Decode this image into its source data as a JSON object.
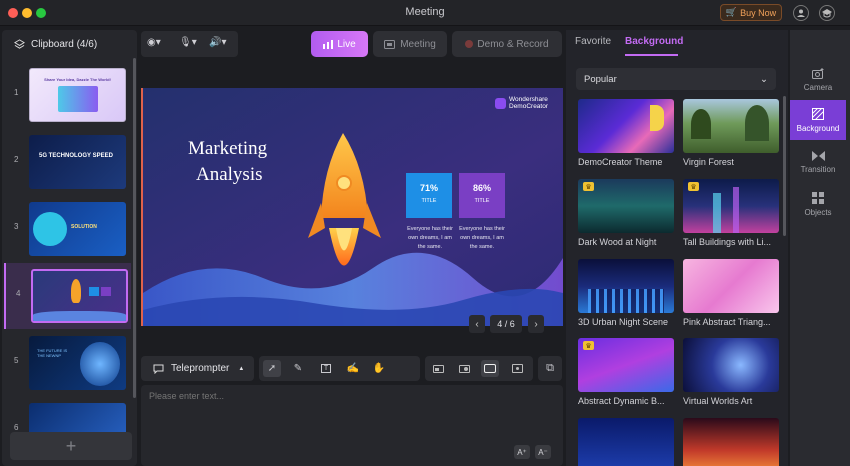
{
  "window": {
    "title": "Meeting"
  },
  "topbar": {
    "buy_now": "Buy Now",
    "buy_icon": "cart-icon",
    "avatar_icon": "user-icon",
    "settings_icon": "graduation-cap-icon"
  },
  "clipboard": {
    "header": "Clipboard (4/6)",
    "slides": [
      {
        "num": "1",
        "caption": "Share Your Idea, Dazzle The World!",
        "selected": false
      },
      {
        "num": "2",
        "caption": "5G TECHNOLOGY SPEED",
        "selected": false
      },
      {
        "num": "3",
        "caption": "SOLUTION",
        "selected": false
      },
      {
        "num": "4",
        "caption": "",
        "selected": true
      },
      {
        "num": "5",
        "caption": "THE FUTURE IS THE NEWNP",
        "selected": false
      },
      {
        "num": "6",
        "caption": "",
        "selected": false
      }
    ],
    "add_label": "+"
  },
  "modes": {
    "live": "Live",
    "meeting": "Meeting",
    "demo": "Demo & Record"
  },
  "slide": {
    "brand": "Wondershare DemoCreator",
    "title_line1": "Marketing",
    "title_line2": "Analysis",
    "stats": [
      {
        "value": "71%",
        "label": "TITLE",
        "color": "#1e8fe6",
        "text": "Everyone has their own dreams, I am the same."
      },
      {
        "value": "86%",
        "label": "TITLE",
        "color": "#7a3fc4",
        "text": "Everyone has their own dreams, I am the same."
      }
    ]
  },
  "pager": {
    "indicator": "4 / 6",
    "prev": "‹",
    "next": "›"
  },
  "teleprompter": {
    "label": "Teleprompter",
    "caret": "▲",
    "placeholder": "Please enter text...",
    "font_larger": "A⁺",
    "font_smaller": "A⁻"
  },
  "tools": [
    "pointer-icon",
    "pen-icon",
    "text-icon",
    "edit-icon",
    "hand-icon"
  ],
  "layouts": [
    "picture-in-picture-icon",
    "side-by-side-icon",
    "screen-only-icon",
    "camera-only-icon"
  ],
  "right": {
    "tabs": {
      "favorite": "Favorite",
      "background": "Background"
    },
    "dropdown": {
      "value": "Popular",
      "arrow": "⌄"
    },
    "backgrounds": [
      {
        "name": "DemoCreator Theme",
        "premium": false
      },
      {
        "name": "Virgin Forest",
        "premium": false
      },
      {
        "name": "Dark Wood at Night",
        "premium": true
      },
      {
        "name": "Tall Buildings with Li...",
        "premium": true
      },
      {
        "name": "3D Urban Night Scene",
        "premium": false
      },
      {
        "name": "Pink Abstract Triang...",
        "premium": false
      },
      {
        "name": "Abstract Dynamic B...",
        "premium": true
      },
      {
        "name": "Virtual Worlds Art",
        "premium": false
      }
    ]
  },
  "sidenav": [
    {
      "label": "Camera",
      "icon": "camera-icon",
      "active": false
    },
    {
      "label": "Background",
      "icon": "background-icon",
      "active": true
    },
    {
      "label": "Transition",
      "icon": "transition-icon",
      "active": false
    },
    {
      "label": "Objects",
      "icon": "objects-icon",
      "active": false
    }
  ],
  "colors": {
    "accent": "#c36bf3",
    "live_gradient_start": "#b25cf0",
    "live_gradient_end": "#d778f6"
  }
}
